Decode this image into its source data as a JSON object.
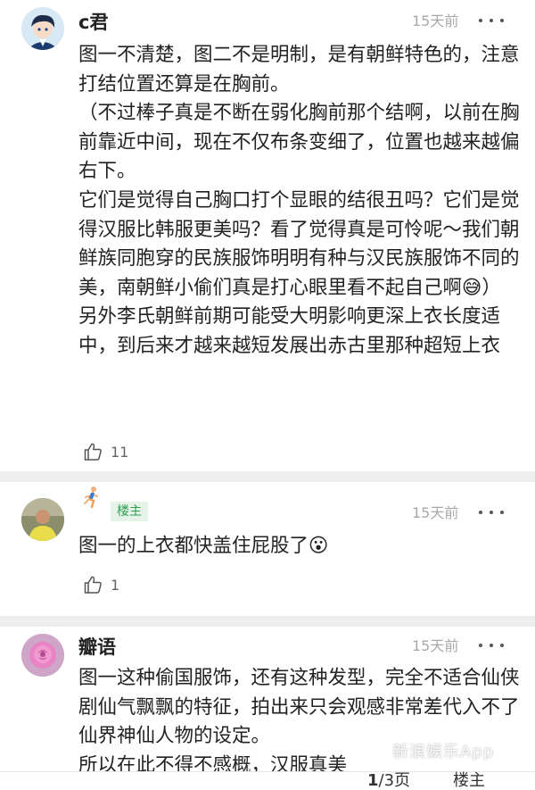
{
  "comments": [
    {
      "name": "c君",
      "time": "15天前",
      "text": "图一不清楚，图二不是明制，是有朝鲜特色的，注意打结位置还算是在胸前。\n（不过棒子真是不断在弱化胸前那个结啊，以前在胸前靠近中间，现在不仅布条变细了，位置也越来越偏右下。\n它们是觉得自己胸口打个显眼的结很丑吗？它们是觉得汉服比韩服更美吗？看了觉得真是可怜呢～我们朝鲜族同胞穿的民族服饰明明有种与汉民族服饰不同的美，南朝鲜小偷们真是打心眼里看不起自己啊😅）\n另外李氏朝鲜前期可能受大明影响更深上衣长度适中，到后来才越来越短发展出赤古里那种超短上衣",
      "likes": "11"
    },
    {
      "name": "",
      "badge": "楼主",
      "time": "15天前",
      "text": "图一的上衣都快盖住屁股了😮",
      "likes": "1"
    },
    {
      "name": "瓣语",
      "time": "15天前",
      "text": "图一这种偷国服饰，还有这种发型，完全不适合仙侠剧仙气飘飘的特征，拍出来只会观感非常差代入不了仙界神仙人物的设定。\n所以在此不得不感概，汉服真美"
    }
  ],
  "pager": {
    "current": "1",
    "rest": "/3页"
  },
  "op_button": "楼主",
  "watermark": "新浪娱乐App",
  "colors": {
    "badge_bg": "#e5f3e8",
    "badge_text": "#2f9e4f",
    "divider": "#eeeeee"
  }
}
